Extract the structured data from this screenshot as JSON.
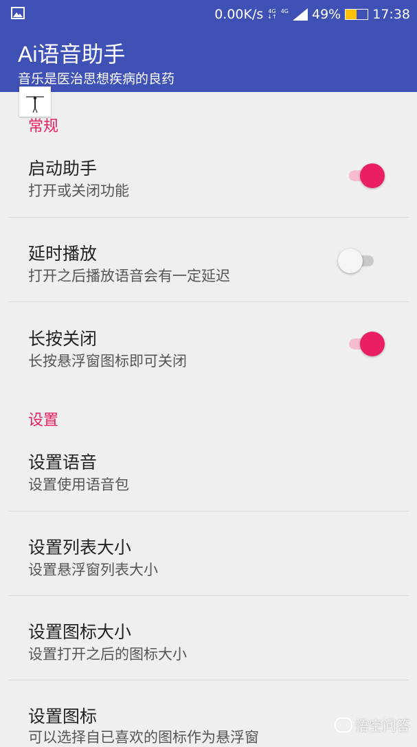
{
  "status_bar": {
    "net_speed": "0.00K/s",
    "signal1": "4G",
    "signal2": "4G",
    "battery": "49%",
    "battery_level": 0.49,
    "time": "17:38"
  },
  "app_bar": {
    "title": "Ai语音助手",
    "subtitle": "音乐是医治思想疾病的良药"
  },
  "sections": [
    {
      "header": "常规",
      "items": [
        {
          "title": "启动助手",
          "summary": "打开或关闭功能",
          "switch_on": true
        },
        {
          "title": "延时播放",
          "summary": "打开之后播放语音会有一定延迟",
          "switch_on": false
        },
        {
          "title": "长按关闭",
          "summary": "长按悬浮窗图标即可关闭",
          "switch_on": true
        }
      ]
    },
    {
      "header": "设置",
      "items": [
        {
          "title": "设置语音",
          "summary": "设置使用语音包"
        },
        {
          "title": "设置列表大小",
          "summary": "设置悬浮窗列表大小"
        },
        {
          "title": "设置图标大小",
          "summary": "设置打开之后的图标大小"
        },
        {
          "title": "设置图标",
          "summary": "可以选择自已喜欢的图标作为悬浮窗"
        }
      ]
    }
  ],
  "watermark": "悟空问答",
  "colors": {
    "primary": "#3f51b5",
    "accent": "#e91e63",
    "background": "#efefef"
  }
}
